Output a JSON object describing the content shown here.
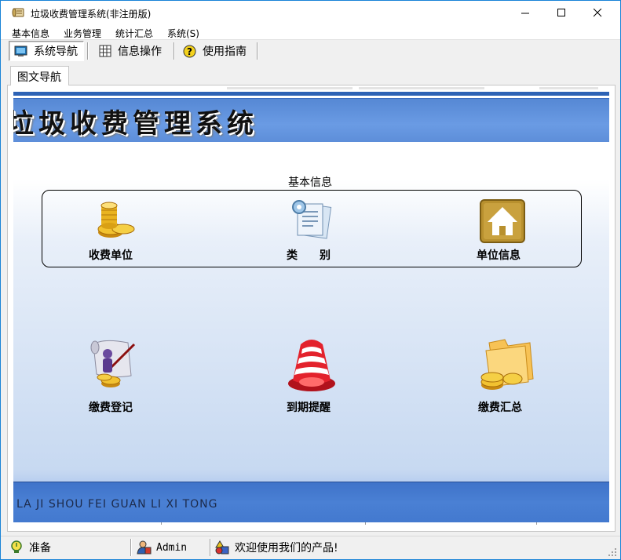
{
  "window": {
    "title": "垃圾收费管理系统(非注册版)"
  },
  "menu": {
    "items": [
      "基本信息",
      "业务管理",
      "统计汇总",
      "系统(S)"
    ]
  },
  "toolbar": {
    "buttons": [
      "系统导航",
      "信息操作",
      "使用指南"
    ]
  },
  "tabs": {
    "items": [
      "图文导航"
    ]
  },
  "banner": {
    "title": "垃圾收费管理系统"
  },
  "basic_group": {
    "caption": "基本信息",
    "items": [
      "收费单位",
      "类　　别",
      "单位信息"
    ]
  },
  "business": {
    "items": [
      "缴费登记",
      "到期提醒",
      "缴费汇总"
    ]
  },
  "footer": {
    "text": "LA JI SHOU FEI GUAN LI XI TONG"
  },
  "status": {
    "state": "准备",
    "user": "Admin",
    "message": "欢迎使用我们的产品!"
  },
  "colors": {
    "banner_blue": "#6a9be4",
    "accent": "#2d62b5",
    "window_border": "#1883d7"
  }
}
